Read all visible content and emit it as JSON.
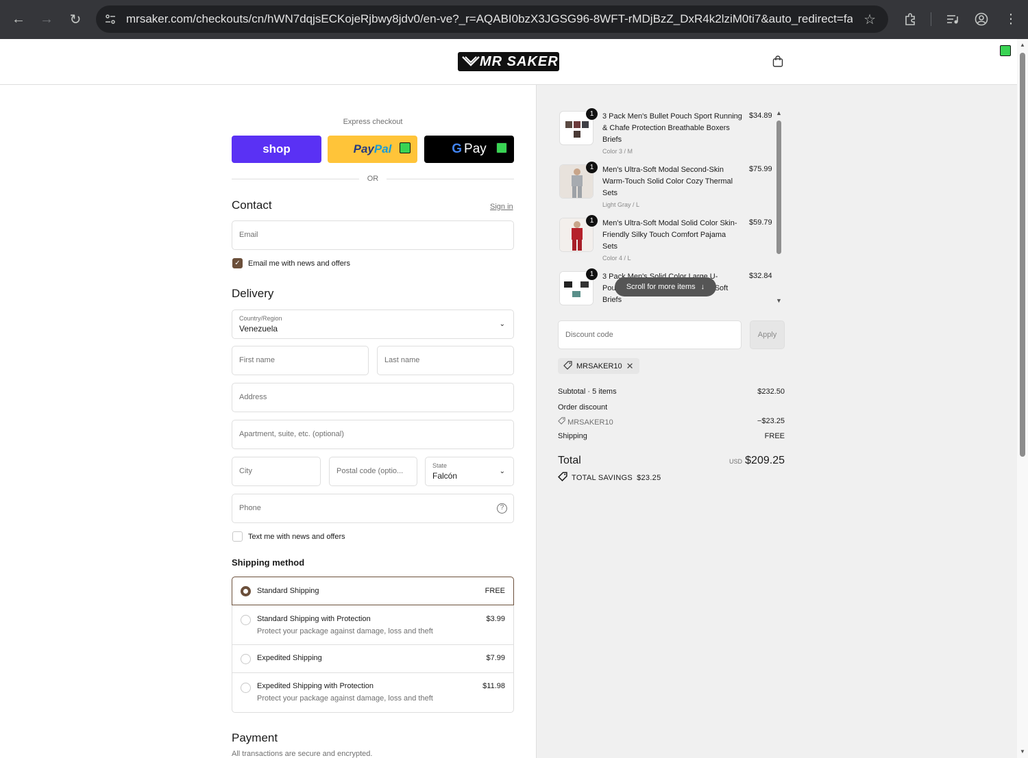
{
  "browser": {
    "url": "mrsaker.com/checkouts/cn/hWN7dqjsECKojeRjbwy8jdv0/en-ve?_r=AQABI0bzX3JGSG96-8WFT-rMDjBzZ_DxR4k2lziM0ti7&auto_redirect=false&e..."
  },
  "header": {
    "logo_text": "MR SAKER"
  },
  "express": {
    "label": "Express checkout",
    "shop_label": "shop",
    "paypal_label_1": "Pay",
    "paypal_label_2": "Pal",
    "gpay_label": "Pay",
    "or_label": "OR"
  },
  "contact": {
    "title": "Contact",
    "signin_label": "Sign in",
    "email_placeholder": "Email",
    "news_label": "Email me with news and offers"
  },
  "delivery": {
    "title": "Delivery",
    "country_label": "Country/Region",
    "country_value": "Venezuela",
    "first_name_placeholder": "First name",
    "last_name_placeholder": "Last name",
    "address_placeholder": "Address",
    "apartment_placeholder": "Apartment, suite, etc. (optional)",
    "city_placeholder": "City",
    "postal_placeholder": "Postal code (optio...",
    "state_label": "State",
    "state_value": "Falcón",
    "phone_placeholder": "Phone",
    "text_news_label": "Text me with news and offers"
  },
  "shipping": {
    "title": "Shipping method",
    "options": [
      {
        "name": "Standard Shipping",
        "sub": "",
        "price": "FREE",
        "selected": true
      },
      {
        "name": "Standard Shipping with Protection",
        "sub": "Protect your package against damage, loss and theft",
        "price": "$3.99",
        "selected": false
      },
      {
        "name": "Expedited Shipping",
        "sub": "",
        "price": "$7.99",
        "selected": false
      },
      {
        "name": "Expedited Shipping with Protection",
        "sub": "Protect your package against damage, loss and theft",
        "price": "$11.98",
        "selected": false
      }
    ]
  },
  "payment": {
    "title": "Payment",
    "subtitle": "All transactions are secure and encrypted."
  },
  "cart": {
    "items": [
      {
        "qty": "1",
        "name": "3 Pack Men's Bullet Pouch Sport Running & Chafe Protection Breathable Boxers Briefs",
        "variant": "Color 3 / M",
        "price": "$34.89"
      },
      {
        "qty": "1",
        "name": "Men's Ultra-Soft Modal Second-Skin Warm-Touch Solid Color Cozy Thermal Sets",
        "variant": "Light Gray / L",
        "price": "$75.99"
      },
      {
        "qty": "1",
        "name": "Men's Ultra-Soft Modal Solid Color Skin-Friendly Silky Touch Comfort Pajama Sets",
        "variant": "Color 4 / L",
        "price": "$59.79"
      },
      {
        "qty": "1",
        "name": "3 Pack Men's Solid Color Large U-Pouch ... Soft Briefs",
        "variant": "",
        "price": "$32.84"
      }
    ],
    "item4_name_1": "3 Pack Men's Solid Color Large U-",
    "item4_name_2a": "Pou",
    "item4_name_2b": "t Soft",
    "item4_name_3": "Briefs",
    "scroll_hint": "Scroll for more items",
    "discount_placeholder": "Discount code",
    "apply_label": "Apply",
    "applied_code": "MRSAKER10"
  },
  "summary": {
    "subtotal_label": "Subtotal · 5 items",
    "subtotal_value": "$232.50",
    "order_discount_label": "Order discount",
    "discount_code": "MRSAKER10",
    "discount_value": "−$23.25",
    "shipping_label": "Shipping",
    "shipping_value": "FREE",
    "total_label": "Total",
    "currency": "USD",
    "total_value": "$209.25",
    "savings_label": "TOTAL SAVINGS",
    "savings_value": "$23.25"
  }
}
